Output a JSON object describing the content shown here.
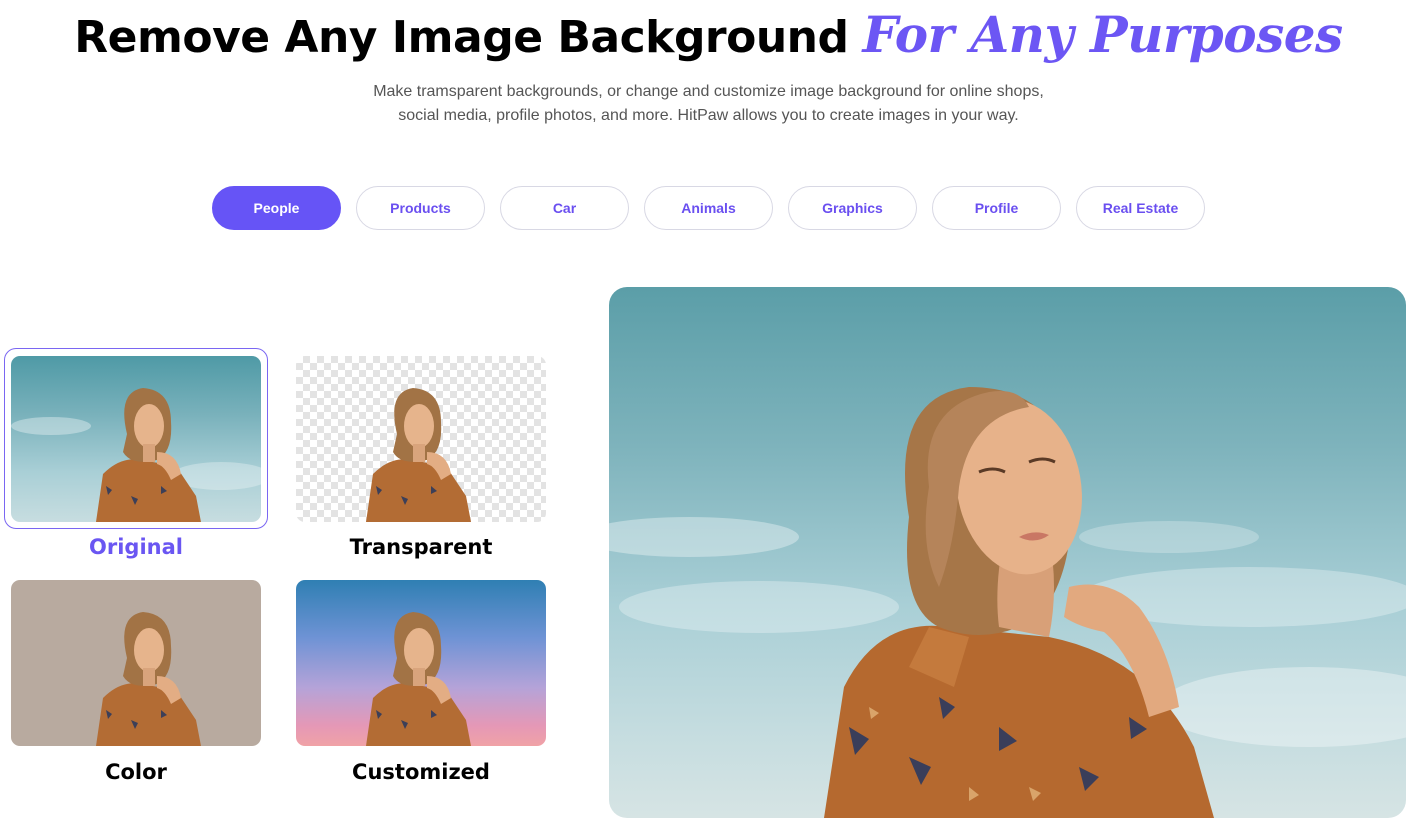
{
  "headline": {
    "main": "Remove Any Image Background",
    "accent": "For Any Purposes",
    "accent_color": "#6c56f4"
  },
  "subtitle": {
    "line1": "Make tramsparent backgrounds, or change and customize image background for online shops,",
    "line2": "social media, profile photos, and more. HitPaw allows you to create images in your way."
  },
  "tabs": [
    {
      "label": "People",
      "active": true
    },
    {
      "label": "Products"
    },
    {
      "label": "Car"
    },
    {
      "label": "Animals"
    },
    {
      "label": "Graphics"
    },
    {
      "label": "Profile"
    },
    {
      "label": "Real Estate"
    }
  ],
  "options": [
    {
      "label": "Original",
      "selected": true
    },
    {
      "label": "Transparent"
    },
    {
      "label": "Color"
    },
    {
      "label": "Customized"
    }
  ],
  "colors": {
    "accent": "#6654f6",
    "tab_text": "#6a4ff0",
    "color_bg": "#b8aa9f"
  }
}
